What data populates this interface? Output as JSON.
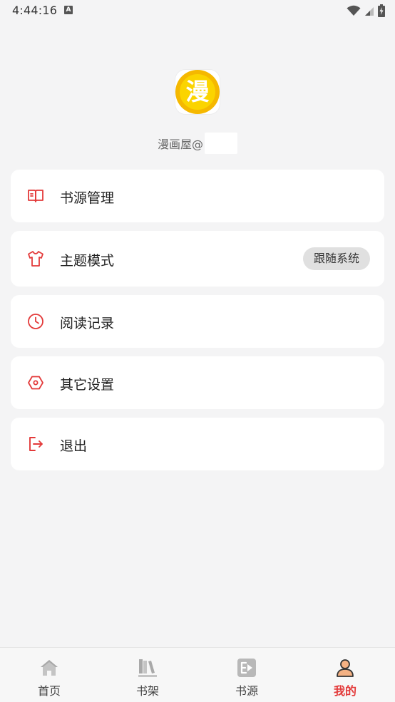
{
  "status_bar": {
    "time": "4:44:16",
    "notification_icon": "a-letter-icon",
    "icons": [
      "wifi-icon",
      "cell-signal-icon",
      "battery-charging-icon"
    ]
  },
  "profile": {
    "logo_icon": "manga-app-logo",
    "logo_glyph": "漫",
    "logo_color": "#f5b800",
    "name": "漫画屋@"
  },
  "menu": {
    "items": [
      {
        "label": "书源管理",
        "icon": "book-open-icon"
      },
      {
        "label": "主题模式",
        "icon": "tshirt-icon",
        "badge": "跟随系统"
      },
      {
        "label": "阅读记录",
        "icon": "clock-icon"
      },
      {
        "label": "其它设置",
        "icon": "settings-hexagon-icon"
      },
      {
        "label": "退出",
        "icon": "logout-icon"
      }
    ]
  },
  "bottom_nav": {
    "items": [
      {
        "label": "首页",
        "icon": "home-icon",
        "active": false
      },
      {
        "label": "书架",
        "icon": "bookshelf-icon",
        "active": false
      },
      {
        "label": "书源",
        "icon": "source-icon",
        "active": false
      },
      {
        "label": "我的",
        "icon": "user-icon",
        "active": true
      }
    ]
  },
  "colors": {
    "accent": "#e33a3a",
    "background": "#f4f4f5",
    "card": "#ffffff",
    "badge_bg": "#e0e0e0"
  }
}
